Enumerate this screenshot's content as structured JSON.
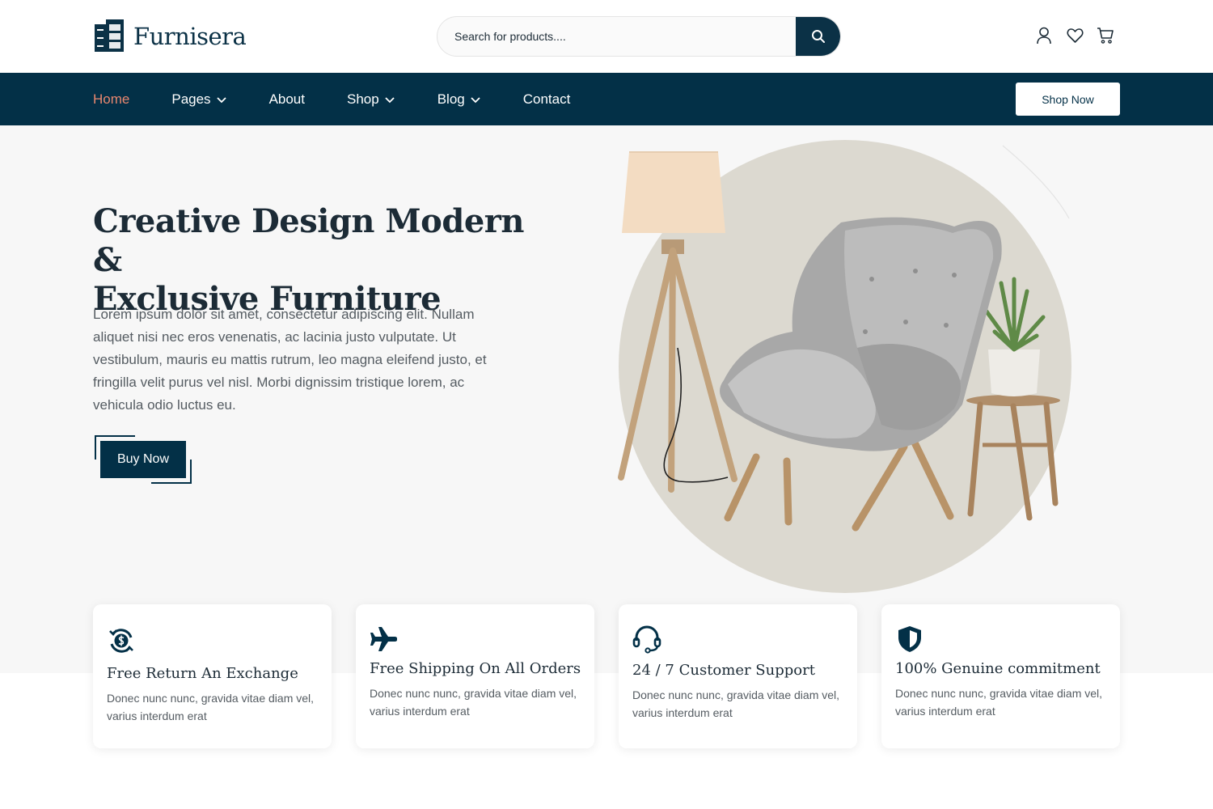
{
  "brand": {
    "name": "Furnisera",
    "color": "#033047"
  },
  "search": {
    "placeholder": "Search for products...."
  },
  "header_icons": [
    "user-icon",
    "heart-icon",
    "cart-icon"
  ],
  "nav": {
    "items": [
      {
        "label": "Home",
        "active": true,
        "dropdown": false
      },
      {
        "label": "Pages",
        "active": false,
        "dropdown": true
      },
      {
        "label": "About",
        "active": false,
        "dropdown": false
      },
      {
        "label": "Shop",
        "active": false,
        "dropdown": true
      },
      {
        "label": "Blog",
        "active": false,
        "dropdown": true
      },
      {
        "label": "Contact",
        "active": false,
        "dropdown": false
      }
    ],
    "cta": "Shop Now",
    "active_color": "#e8876f"
  },
  "hero": {
    "title_line1": "Creative Design Modern &",
    "title_line2": "Exclusive Furniture",
    "text": "Lorem ipsum dolor sit amet, consectetur adipiscing elit. Nullam aliquet nisi nec eros venenatis, ac lacinia justo vulputate. Ut vestibulum, mauris eu mattis rutrum, leo magna eleifend justo, et fringilla velit purus vel nisl. Morbi dignissim tristique lorem, ac vehicula odio luctus eu.",
    "button": "Buy Now",
    "image": "armchair-floor-lamp-side-table-plant"
  },
  "features": [
    {
      "icon": "money-exchange-icon",
      "title": "Free Return An Exchange",
      "desc": "Donec nunc nunc, gravida vitae diam vel, varius interdum erat"
    },
    {
      "icon": "airplane-icon",
      "title": "Free Shipping On All Orders",
      "desc": "Donec nunc nunc, gravida vitae diam vel, varius interdum erat"
    },
    {
      "icon": "headset-icon",
      "title": "24 / 7 Customer Support",
      "desc": "Donec nunc nunc, gravida vitae diam vel, varius interdum erat"
    },
    {
      "icon": "shield-icon",
      "title": "100% Genuine commitment",
      "desc": "Donec nunc nunc, gravida vitae diam vel, varius interdum erat"
    }
  ]
}
